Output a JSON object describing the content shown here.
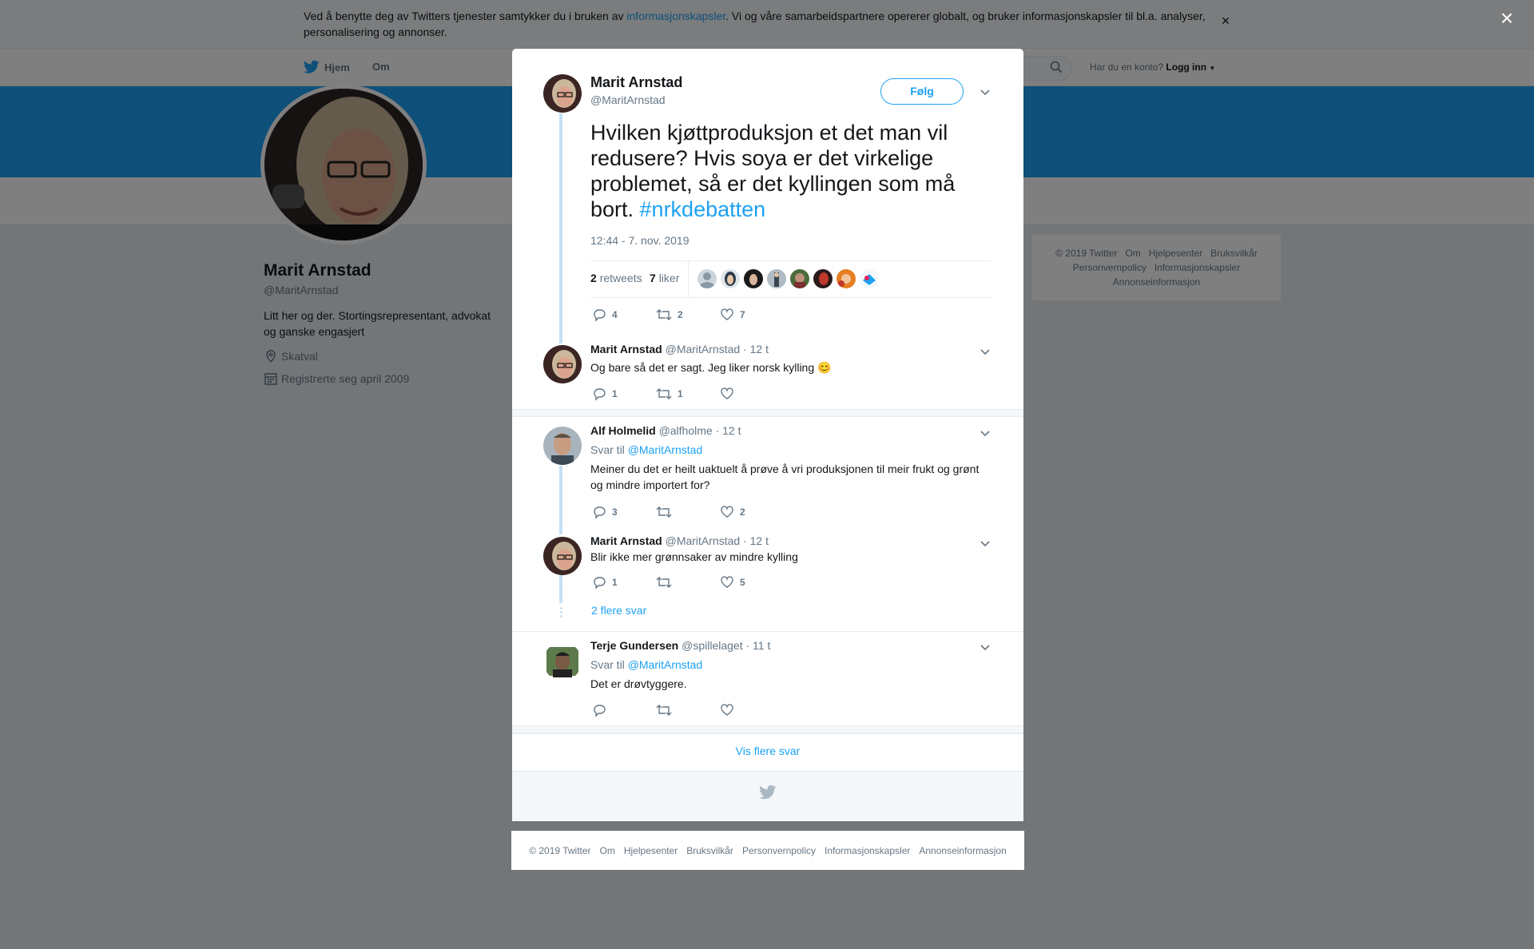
{
  "cookie_bar": {
    "text_before": "Ved å benytte deg av Twitters tjenester samtykker du i bruken av ",
    "link": "informasjonskapsler",
    "text_after": ". Vi og våre samarbeidspartnere opererer globalt, og bruker informasjonskapsler til bl.a. analyser, personalisering og annonser.",
    "close_glyph": "×"
  },
  "topnav": {
    "home": "Hjem",
    "about": "Om",
    "account_prompt": "Har du en konto?",
    "login": "Logg inn"
  },
  "profile": {
    "name": "Marit Arnstad",
    "handle": "@MaritArnstad",
    "bio": "Litt her og der. Stortingsrepresentant, advokat og ganske engasjert",
    "location": "Skatval",
    "joined": "Registrerte seg april 2009"
  },
  "side_footer": [
    "© 2019 Twitter",
    "Om",
    "Hjelpesenter",
    "Bruksvilkår",
    "Personvernpolicy",
    "Informasjonskapsler",
    "Annonseinformasjon"
  ],
  "overlay_close": "×",
  "main_tweet": {
    "name": "Marit Arnstad",
    "handle": "@MaritArnstad",
    "follow": "Følg",
    "text": "Hvilken kjøttproduksjon et det man vil redusere? Hvis soya er det virkelige problemet, så er det kyllingen som må bort. ",
    "hashtag": "#nrkdebatten",
    "time": "12:44 - 7. nov. 2019",
    "retweets_count": "2",
    "retweets_label": "retweets",
    "likes_count": "7",
    "likes_label": "liker",
    "actions": {
      "replies": "4",
      "retweets": "2",
      "likes": "7"
    }
  },
  "replies": [
    {
      "name": "Marit Arnstad",
      "handle": "@MaritArnstad",
      "time": "· 12 t",
      "text": "Og bare så det er sagt. Jeg liker norsk kylling",
      "emoji": "😊",
      "actions": {
        "replies": "1",
        "retweets": "1",
        "likes": ""
      }
    },
    {
      "name": "Alf Holmelid",
      "handle": "@alfholme",
      "time": "· 12 t",
      "reply_to_label": "Svar til",
      "reply_to": "@MaritArnstad",
      "text": "Meiner du det er heilt uaktuelt å prøve å vri produksjonen til meir frukt og grønt og mindre importert for?",
      "actions": {
        "replies": "3",
        "retweets": "",
        "likes": "2"
      }
    },
    {
      "name": "Marit Arnstad",
      "handle": "@MaritArnstad",
      "time": "· 12 t",
      "text": "Blir ikke mer grønnsaker av mindre kylling",
      "actions": {
        "replies": "1",
        "retweets": "",
        "likes": "5"
      }
    },
    {
      "name": "Terje Gundersen",
      "handle": "@spillelaget",
      "time": "· 11 t",
      "reply_to_label": "Svar til",
      "reply_to": "@MaritArnstad",
      "text": "Det er drøvtyggere.",
      "actions": {
        "replies": "",
        "retweets": "",
        "likes": ""
      }
    }
  ],
  "more_replies": "2 flere svar",
  "show_more": "Vis flere svar",
  "bottom_footer": [
    "© 2019 Twitter",
    "Om",
    "Hjelpesenter",
    "Bruksvilkår",
    "Personvernpolicy",
    "Informasjonskapsler",
    "Annonseinformasjon"
  ],
  "icons": {
    "twitter_bird": "twitter-bird-icon",
    "search": "search-icon",
    "location": "location-pin-icon",
    "calendar": "calendar-icon",
    "reply": "reply-icon",
    "retweet": "retweet-icon",
    "like": "heart-icon",
    "chevron": "chevron-down-icon",
    "close": "close-icon"
  },
  "colors": {
    "accent": "#1da1f2",
    "banner": "#1da1f2",
    "text": "#14171a",
    "muted": "#657786"
  }
}
